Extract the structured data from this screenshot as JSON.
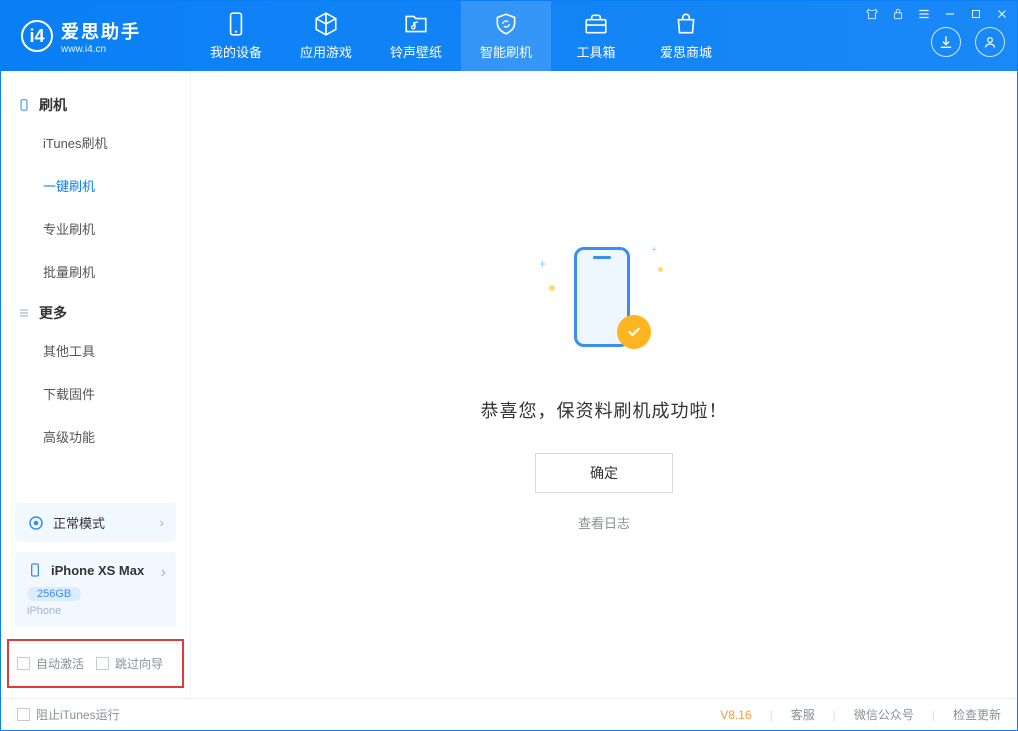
{
  "app": {
    "name": "爱思助手",
    "domain": "www.i4.cn"
  },
  "nav": [
    {
      "label": "我的设备"
    },
    {
      "label": "应用游戏"
    },
    {
      "label": "铃声壁纸"
    },
    {
      "label": "智能刷机"
    },
    {
      "label": "工具箱"
    },
    {
      "label": "爱思商城"
    }
  ],
  "sidebar": {
    "section1": {
      "title": "刷机",
      "items": [
        "iTunes刷机",
        "一键刷机",
        "专业刷机",
        "批量刷机"
      ]
    },
    "section2": {
      "title": "更多",
      "items": [
        "其他工具",
        "下载固件",
        "高级功能"
      ]
    },
    "mode": "正常模式",
    "device": {
      "name": "iPhone XS Max",
      "storage": "256GB",
      "type": "iPhone"
    },
    "options": {
      "auto_activate": "自动激活",
      "skip_guide": "跳过向导"
    }
  },
  "main": {
    "success_message": "恭喜您，保资料刷机成功啦！",
    "ok_button": "确定",
    "view_log": "查看日志"
  },
  "statusbar": {
    "block_itunes": "阻止iTunes运行",
    "version": "V8.16",
    "links": [
      "客服",
      "微信公众号",
      "检查更新"
    ]
  }
}
